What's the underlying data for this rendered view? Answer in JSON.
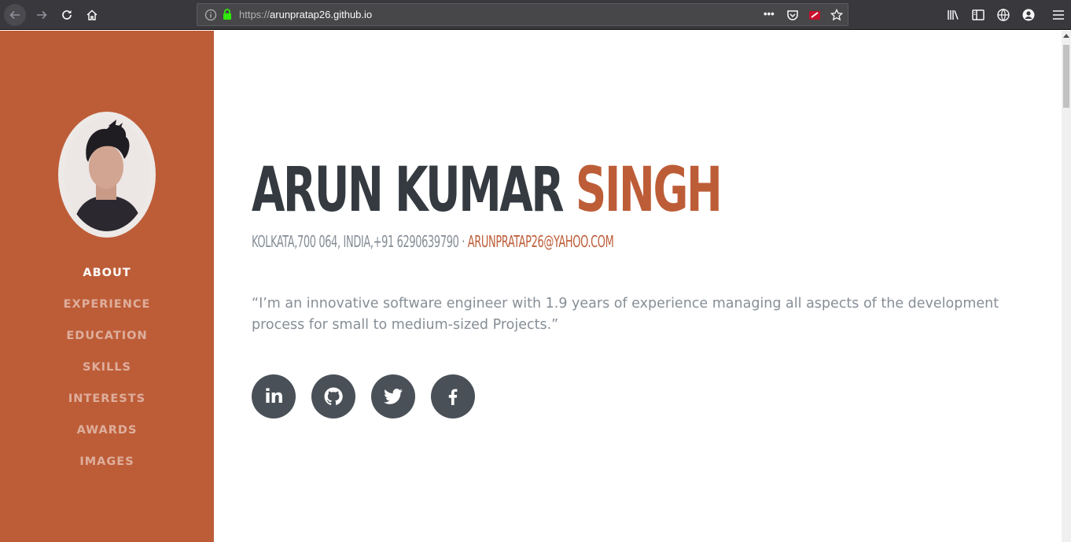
{
  "browser": {
    "url_scheme": "https://",
    "url_host": "arunpratap26.github.io",
    "more_label": "•••"
  },
  "sidebar": {
    "accent_color": "#bd5d38",
    "nav": [
      {
        "label": "About",
        "active": true
      },
      {
        "label": "Experience",
        "active": false
      },
      {
        "label": "Education",
        "active": false
      },
      {
        "label": "Skills",
        "active": false
      },
      {
        "label": "Interests",
        "active": false
      },
      {
        "label": "Awards",
        "active": false
      },
      {
        "label": "Images",
        "active": false
      }
    ]
  },
  "about": {
    "first_name": "Arun Kumar",
    "last_name": "Singh",
    "address": "Kolkata,700 064, India,+91 6290639790 ·",
    "email": "arunpratap26@yahoo.com",
    "lead": "“I’m an innovative software engineer with 1.9 years of experience managing all aspects of the development process for small to medium-sized Projects.”",
    "social": [
      {
        "icon": "linkedin-icon",
        "text": "in"
      },
      {
        "icon": "github-icon"
      },
      {
        "icon": "twitter-icon"
      },
      {
        "icon": "facebook-icon"
      }
    ]
  }
}
